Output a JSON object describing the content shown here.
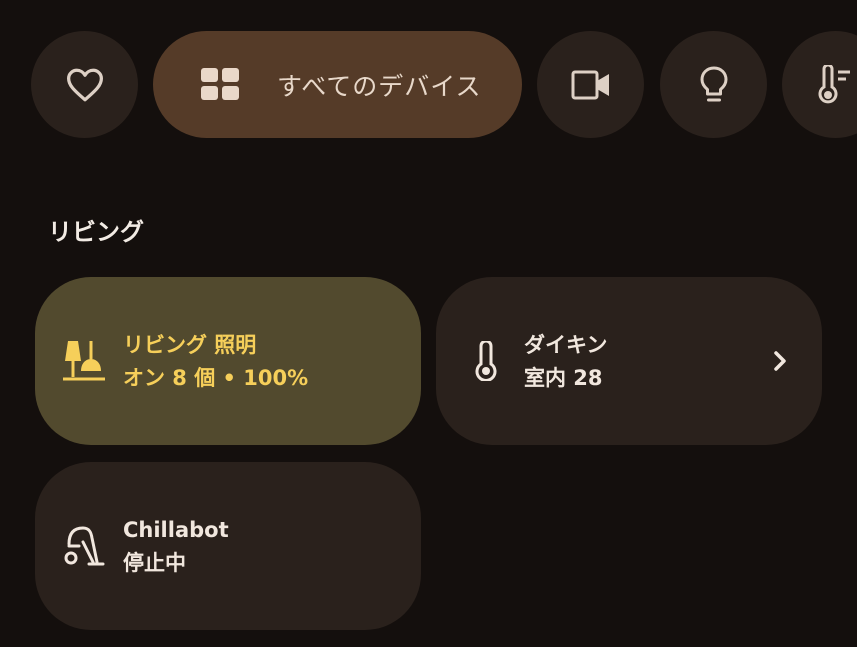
{
  "filters": {
    "favorites_icon": "heart-icon",
    "all_devices": {
      "label": "すべてのデバイス",
      "icon": "grid-icon"
    },
    "cameras_icon": "camera-icon",
    "lights_icon": "lightbulb-icon",
    "climate_icon": "thermostat-icon"
  },
  "section": {
    "title": "リビング"
  },
  "devices": [
    {
      "name": "リビング 照明",
      "status": "オン 8 個 • 100%",
      "icon": "lamp-icon",
      "state": "on"
    },
    {
      "name": "ダイキン",
      "status": "室内 28",
      "icon": "thermometer-icon",
      "state": "off",
      "has_chevron": true
    },
    {
      "name": "Chillabot",
      "status": "停止中",
      "icon": "vacuum-icon",
      "state": "off"
    }
  ],
  "colors": {
    "background": "#140f0d",
    "chip": "#2a211c",
    "chip_selected": "#553b28",
    "tile_on": "#524a2e",
    "tile_on_text": "#f6cf5a"
  }
}
